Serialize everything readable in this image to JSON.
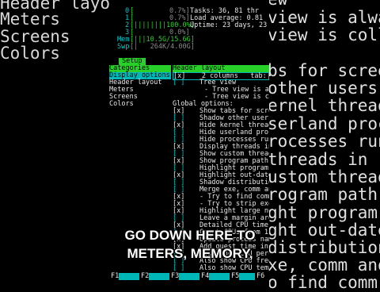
{
  "background_left": [
    "Header layout",
    "Meters",
    "Screens",
    "Colors"
  ],
  "background_right": [
    "ew",
    "view is alwa",
    "view is coll",
    "",
    "bs for scree",
    "other users'",
    "ernel threads",
    "serland proce",
    "rocesses runn",
    "threads in",
    "ustom thread",
    "rogram path",
    "ght program \"",
    "ght out-dated",
    "distribution",
    "xe, comm and",
    "o find comm"
  ],
  "meters": {
    "cpu_rows": [
      {
        "num": "0",
        "bar": "[",
        "pct": "0.7%]"
      },
      {
        "num": "1",
        "bar": "[",
        "pct": "0.7%]"
      },
      {
        "num": "2",
        "bar": "[||||||||100.0%]",
        "pct": ""
      },
      {
        "num": "3",
        "bar": "[",
        "pct": "0.0%]"
      }
    ],
    "mem_label": "Mem",
    "mem_value": "[|||10.5G/15.6G]",
    "swp_label": "Swp",
    "swp_value": "[|   264K/4.00G]",
    "tasks": "Tasks: 36, 81 thr",
    "load": "Load average: 0.81",
    "uptime": "Uptime: 23 days, 23"
  },
  "setup_tab": "Setup",
  "categories": {
    "title": "Categories",
    "items": [
      "Display options",
      "Header layout",
      "Meters",
      "Screens",
      "Colors"
    ]
  },
  "options": {
    "header": "Header layout",
    "columns_row": "[x]    2 columns   tab: Ma",
    "lines": [
      {
        "box": "[ ]",
        "text": "Tree view"
      },
      {
        "box": "",
        "text": "- Tree view is alwa"
      },
      {
        "box": "",
        "text": "- Tree view is coll"
      },
      {
        "box": "Global options:",
        "text": ""
      },
      {
        "box": "[x]",
        "text": "Show tabs for scree"
      },
      {
        "box": "[ ]",
        "text": "Shadow other users'"
      },
      {
        "box": "[x]",
        "text": "Hide kernel threads"
      },
      {
        "box": "[ ]",
        "text": "Hide userland proce"
      },
      {
        "box": "[ ]",
        "text": "Hide processes runn"
      },
      {
        "box": "[x]",
        "text": "Display threads in"
      },
      {
        "box": "[ ]",
        "text": "Show custom thread"
      },
      {
        "box": "[x]",
        "text": "Show program path"
      },
      {
        "box": "[ ]",
        "text": "Highlight program \""
      },
      {
        "box": "[x]",
        "text": "Highlight out-dated"
      },
      {
        "box": "[ ]",
        "text": "Shadow distribution"
      },
      {
        "box": "[ ]",
        "text": "Merge exe, comm and"
      },
      {
        "box": "[x]",
        "text": "- Try to find comm"
      },
      {
        "box": "[x]",
        "text": "- Try to strip exe"
      },
      {
        "box": "[x]",
        "text": "Highlight large num"
      },
      {
        "box": "[ ]",
        "text": "Leave a margin arou"
      },
      {
        "box": "[x]",
        "text": "Detailed CPU time ("
      },
      {
        "box": "[ ]",
        "text": "Count CPUs from 1"
      },
      {
        "box": "[x]",
        "text": "Update process name"
      },
      {
        "box": "[x]",
        "text": "Add guest time in C"
      },
      {
        "box": "[ ]",
        "text": "Also show CPU perce"
      },
      {
        "box": "[ ]",
        "text": "Also show CPU frequ"
      },
      {
        "box": "[ ]",
        "text": "Also show CPU tempe"
      }
    ]
  },
  "fkeys": [
    "F1",
    "F2",
    "F3",
    "F4",
    "F5",
    "F6"
  ],
  "caption": {
    "line1": "GO DOWN HERE TO",
    "line2": "METERS, MEMORY,"
  }
}
